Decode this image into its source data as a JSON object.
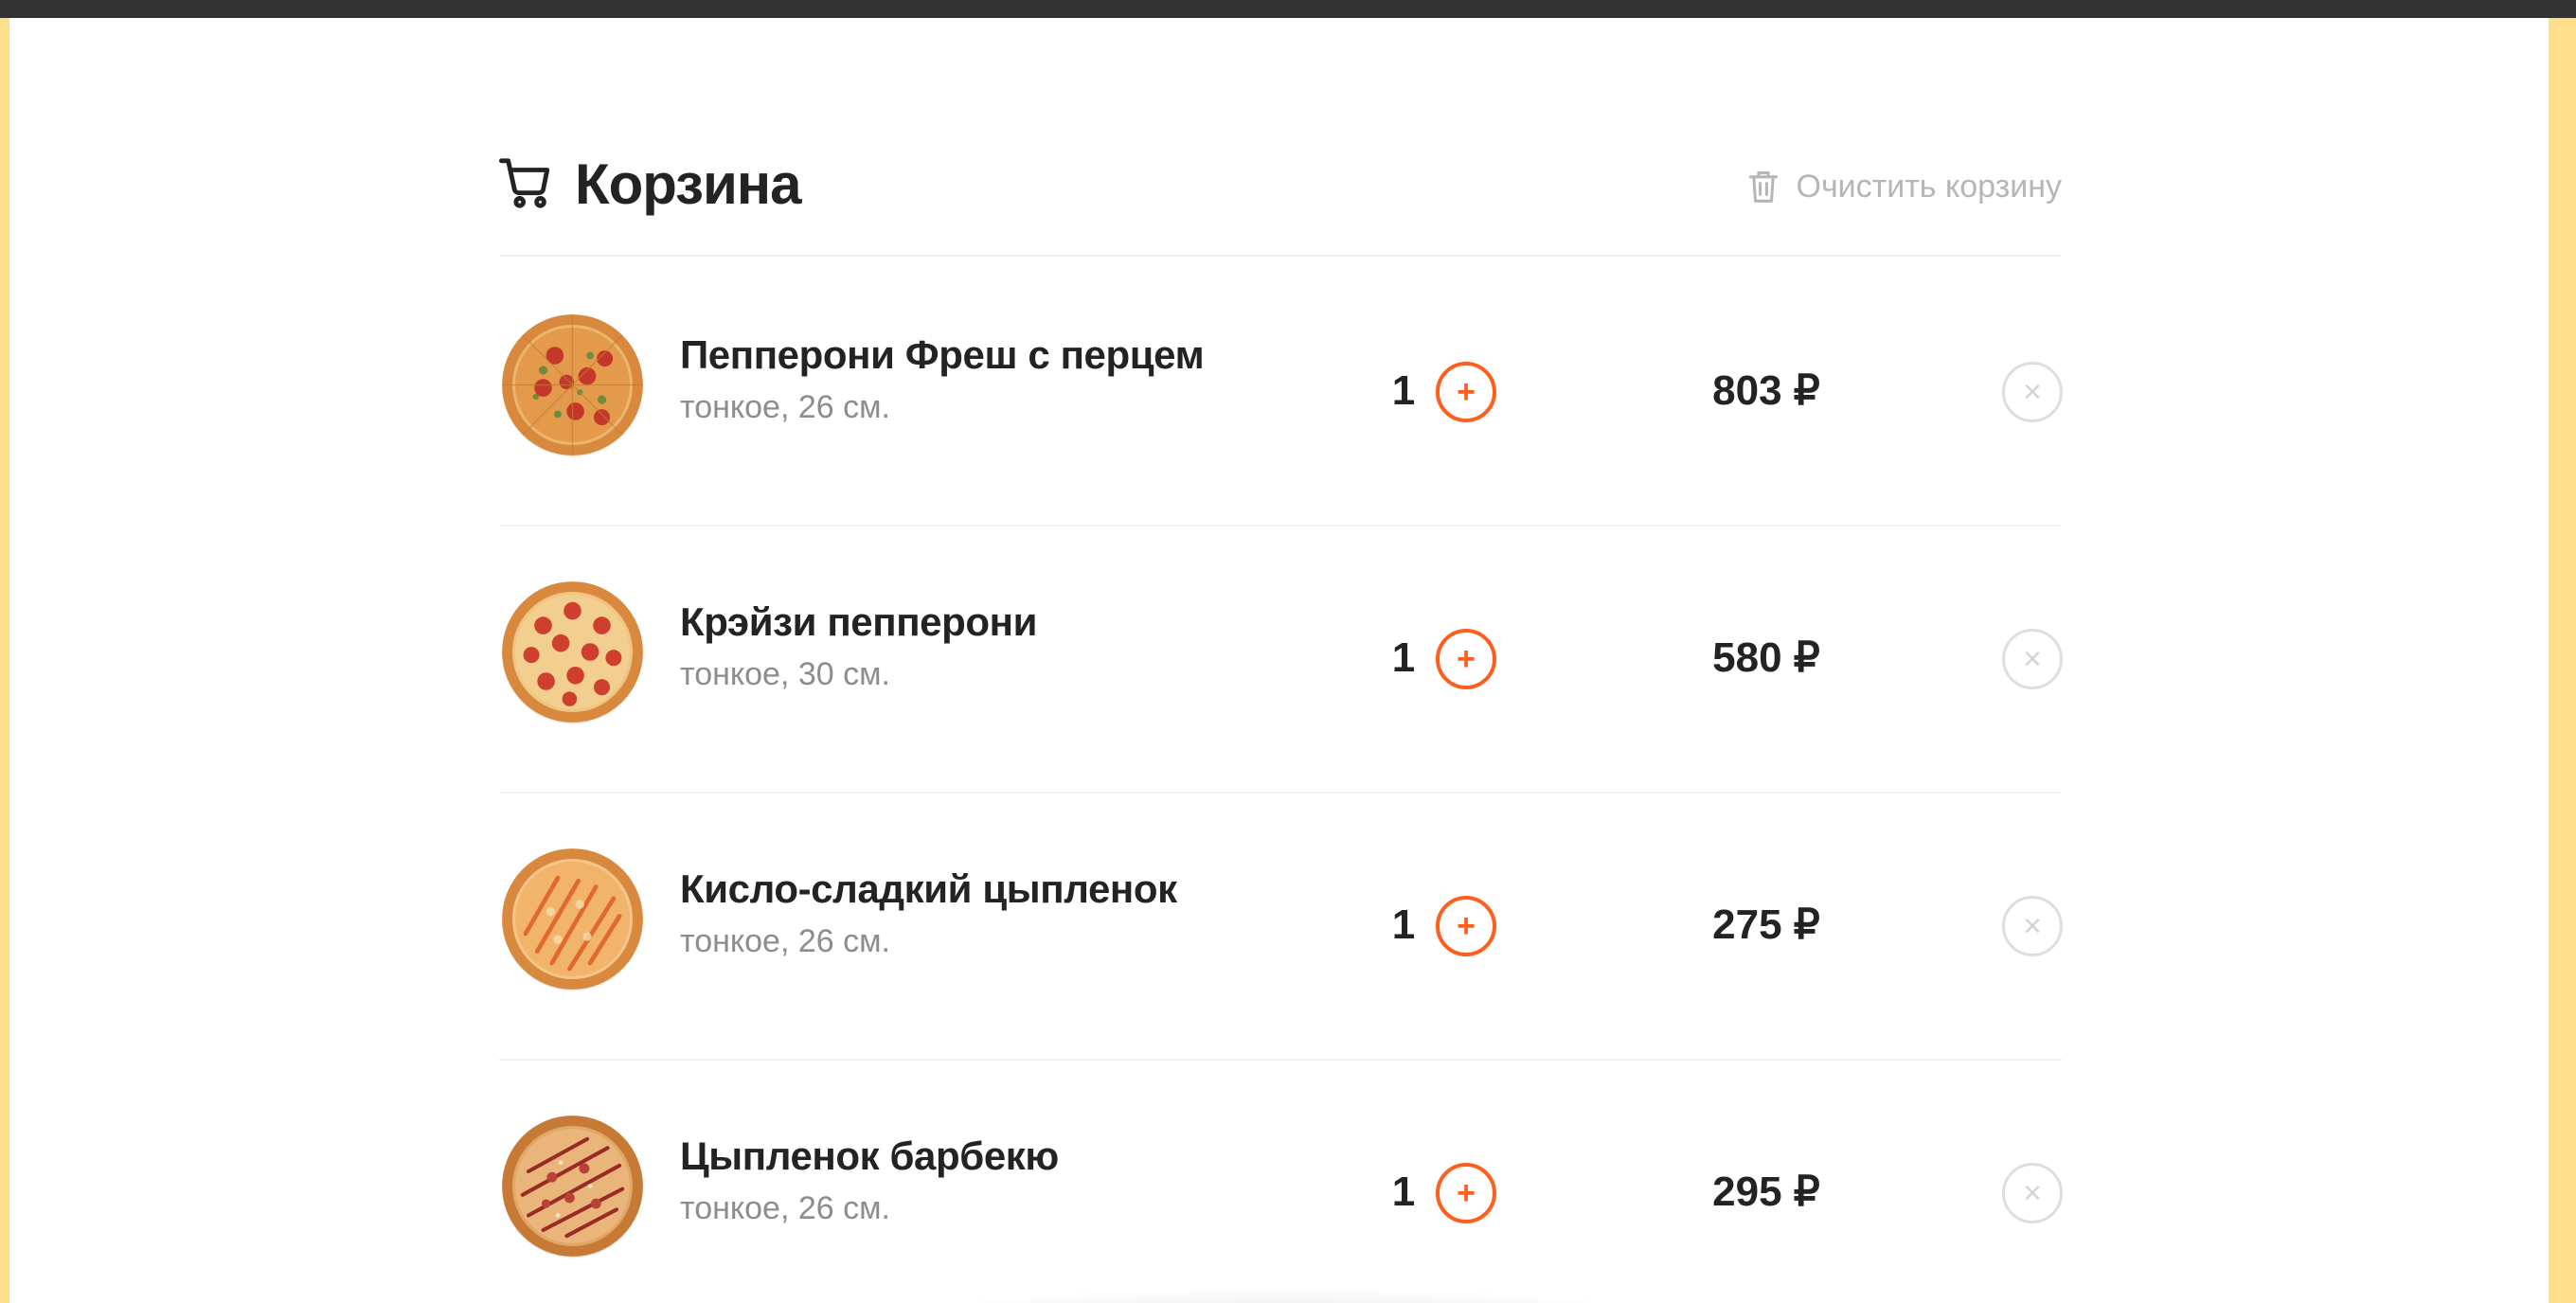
{
  "colors": {
    "accent": "#fe5f1e",
    "side_background": "#ffdf8c",
    "topbar": "#333333",
    "text_primary": "#232323",
    "text_secondary": "#8d8d8d",
    "muted": "#b6b6b6"
  },
  "cart": {
    "title": "Корзина",
    "title_icon": "cart-icon",
    "clear_label": "Очистить корзину",
    "clear_icon": "trash-icon"
  },
  "items": [
    {
      "name": "Пепперони Фреш с перцем",
      "desc": "тонкое, 26 см.",
      "qty": "1",
      "price": "803 ₽",
      "image": "pizza-pepperoni-fresh",
      "plus": "+",
      "remove": "×"
    },
    {
      "name": "Крэйзи пепперони",
      "desc": "тонкое, 30 см.",
      "qty": "1",
      "price": "580 ₽",
      "image": "pizza-crazy-pepperoni",
      "plus": "+",
      "remove": "×"
    },
    {
      "name": "Кисло-сладкий цыпленок",
      "desc": "тонкое, 26 см.",
      "qty": "1",
      "price": "275 ₽",
      "image": "pizza-sweet-sour-chicken",
      "plus": "+",
      "remove": "×"
    },
    {
      "name": "Цыпленок барбекю",
      "desc": "тонкое, 26 см.",
      "qty": "1",
      "price": "295 ₽",
      "image": "pizza-bbq-chicken",
      "plus": "+",
      "remove": "×"
    }
  ]
}
